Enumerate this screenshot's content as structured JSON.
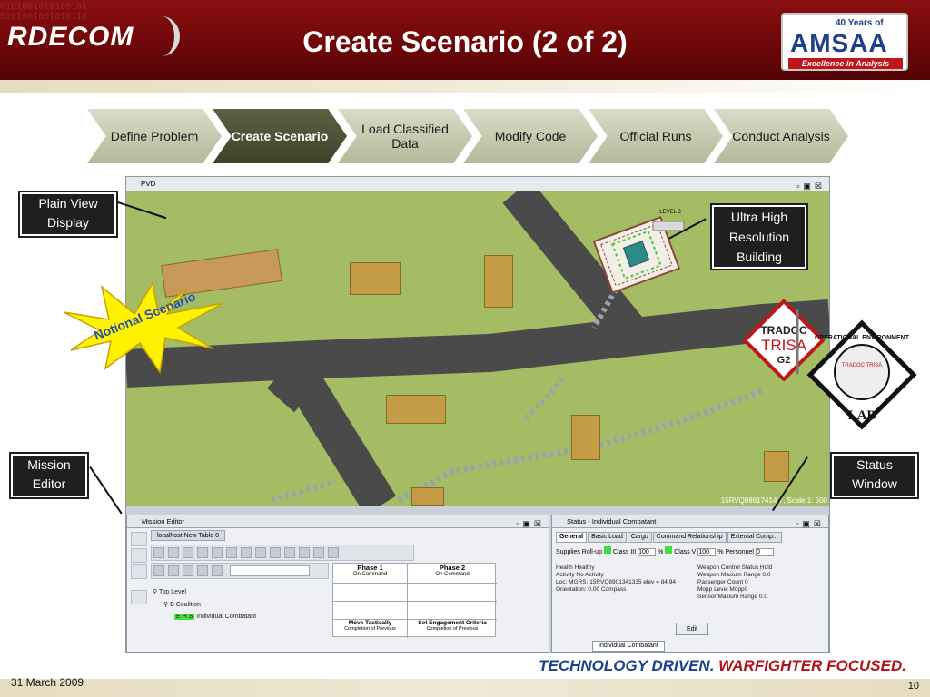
{
  "header": {
    "left_logo": "RDECOM",
    "title": "Create Scenario (2 of 2)",
    "right_logo": {
      "years": "40 Years of",
      "name": "AMSAA",
      "tagline": "Excellence in Analysis"
    }
  },
  "process_steps": [
    {
      "label": "Define Problem",
      "active": false
    },
    {
      "label": "Create Scenario",
      "active": true
    },
    {
      "label": "Load Classified Data",
      "active": false
    },
    {
      "label": "Modify Code",
      "active": false
    },
    {
      "label": "Official Runs",
      "active": false
    },
    {
      "label": "Conduct Analysis",
      "active": false
    }
  ],
  "pvd": {
    "window_title": "PVD",
    "level_label": "LEVEL 3",
    "coords": "15RVQ88617414.7, Scale 1: 500"
  },
  "mission_editor": {
    "window_title": "Mission Editor",
    "tab": "localhost:New Table 0",
    "phase1": {
      "title": "Phase 1",
      "sub": "On Command",
      "task": "Move Tactically",
      "task_sub": "Completion of Previous"
    },
    "phase2": {
      "title": "Phase 2",
      "sub": "On Command",
      "task": "Set Engagement Criteria",
      "task_sub": "Completion of Previous"
    },
    "tree": {
      "root": "Top Level",
      "coalition": "Coalition",
      "unit": "Individual Combatant",
      "badge": "E H S"
    }
  },
  "status_window": {
    "window_title": "Status - Individual Combatant",
    "tabs": [
      "General",
      "Basic Load",
      "Cargo",
      "Command Relationship",
      "External Comp..."
    ],
    "supplies": {
      "label": "Supplies Roll-up",
      "class3": "Class III",
      "class3_val": "100",
      "class5": "Class V",
      "class5_val": "100",
      "personnel": "Personnel",
      "personnel_val": "0",
      "pct": "%"
    },
    "left_fields": [
      "Health        Healthy",
      "Activity      No Activity",
      "Loc: MGRS: 15RVQ8901341335 elev = 84.94",
      "Orientation:              0.00  Compass"
    ],
    "right_fields": [
      "Weapon Control Status  Hold",
      "Weapon Maxium Range  0.0",
      "Passenger Count         0",
      "Mopp Level               Mopp0",
      "Sensor Maxium Range  0.0"
    ],
    "edit_label": "Edit",
    "bottom_tab": "Individual Combatant"
  },
  "callouts": {
    "plain_view": "Plain View Display",
    "ultra_high": "Ultra High Resolution Building",
    "mission_editor": "Mission Editor",
    "status_window": "Status Window",
    "notional": "Notional Scenario"
  },
  "badges": {
    "trisa_top": "TRADOC",
    "trisa_mid": "TRISA",
    "trisa_bottom": "G2",
    "lab_ring": "OPERATIONAL ENVIRONMENT",
    "lab_center": "TRADOC TRISA",
    "lab_bottom": "LAB"
  },
  "footer": {
    "tag1": "TECHNOLOGY DRIVEN.",
    "tag2": "WARFIGHTER FOCUSED.",
    "date": "31 March 2009",
    "page": "10"
  },
  "colors": {
    "header_red": "#6a0608",
    "chevron_active": "#3e4129",
    "terrain_green": "#a4bd64",
    "road_gray": "#4a4a4a",
    "building_tan": "#c49c45",
    "burst_yellow": "#fff200"
  }
}
